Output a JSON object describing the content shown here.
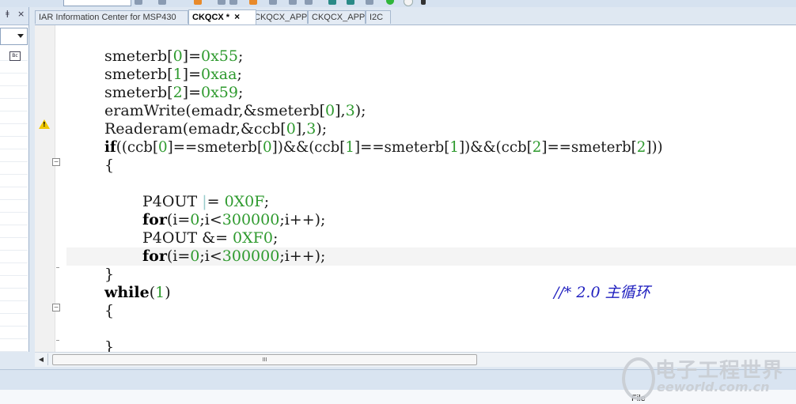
{
  "tabs": [
    {
      "label": "IAR Information Center for MSP430",
      "active": false
    },
    {
      "label": "CKQCX *",
      "active": true,
      "close": "×"
    },
    {
      "label": "CKQCX_APP",
      "active": false
    },
    {
      "label": "CKQCX_APP",
      "active": false
    },
    {
      "label": "I2C",
      "active": false
    }
  ],
  "left_panel": {
    "pin": "ǂ",
    "close": "×",
    "list_icon": "Bc"
  },
  "code": {
    "l1": {
      "a": "smeterb[",
      "n1": "0",
      "b": "]=",
      "n2": "0x55",
      "c": ";"
    },
    "l2": {
      "a": "smeterb[",
      "n1": "1",
      "b": "]=",
      "n2": "0xaa",
      "c": ";"
    },
    "l3": {
      "a": "smeterb[",
      "n1": "2",
      "b": "]=",
      "n2": "0x59",
      "c": ";"
    },
    "l4": {
      "a": "eramWrite(emadr,&smeterb[",
      "n1": "0",
      "b": "],",
      "n2": "3",
      "c": ");"
    },
    "l5": {
      "a": "Readeram(emadr,&ccb[",
      "n1": "0",
      "b": "],",
      "n2": "3",
      "c": ");"
    },
    "l6": {
      "kw": "if",
      "a": "((ccb[",
      "n1": "0",
      "b": "]==smeterb[",
      "n2": "0",
      "c": "])&&(ccb[",
      "n3": "1",
      "d": "]==smeterb[",
      "n4": "1",
      "e": "])&&(ccb[",
      "n5": "2",
      "f": "]==smeterb[",
      "n6": "2",
      "g": "]))"
    },
    "l7": {
      "a": "{"
    },
    "l9": {
      "a": "P4OUT ",
      "bar": "|",
      "b": "= ",
      "n1": "0X0F",
      "c": ";"
    },
    "l10": {
      "kw": "for",
      "a": "(i=",
      "n1": "0",
      "b": ";i<",
      "n2": "300000",
      "c": ";i++);"
    },
    "l11": {
      "a": "P4OUT &= ",
      "n1": "0XF0",
      "c": ";"
    },
    "l12": {
      "kw": "for",
      "a": "(i=",
      "n1": "0",
      "b": ";i<",
      "n2": "300000",
      "c": ";i++);"
    },
    "l13": {
      "a": "}"
    },
    "l14": {
      "kw": "while",
      "a": "(",
      "n1": "1",
      "b": ")",
      "comment": "//* 2.0 主循环"
    },
    "l15": {
      "a": "{"
    },
    "l17": {
      "a": "}"
    }
  },
  "gutter": {
    "warning": "!"
  },
  "scrollbar": {
    "thumb_grip": "III"
  },
  "status": {
    "file_label": "File"
  },
  "watermark": {
    "cn": "电子工程世界",
    "en": "eeworld.com.cn"
  }
}
